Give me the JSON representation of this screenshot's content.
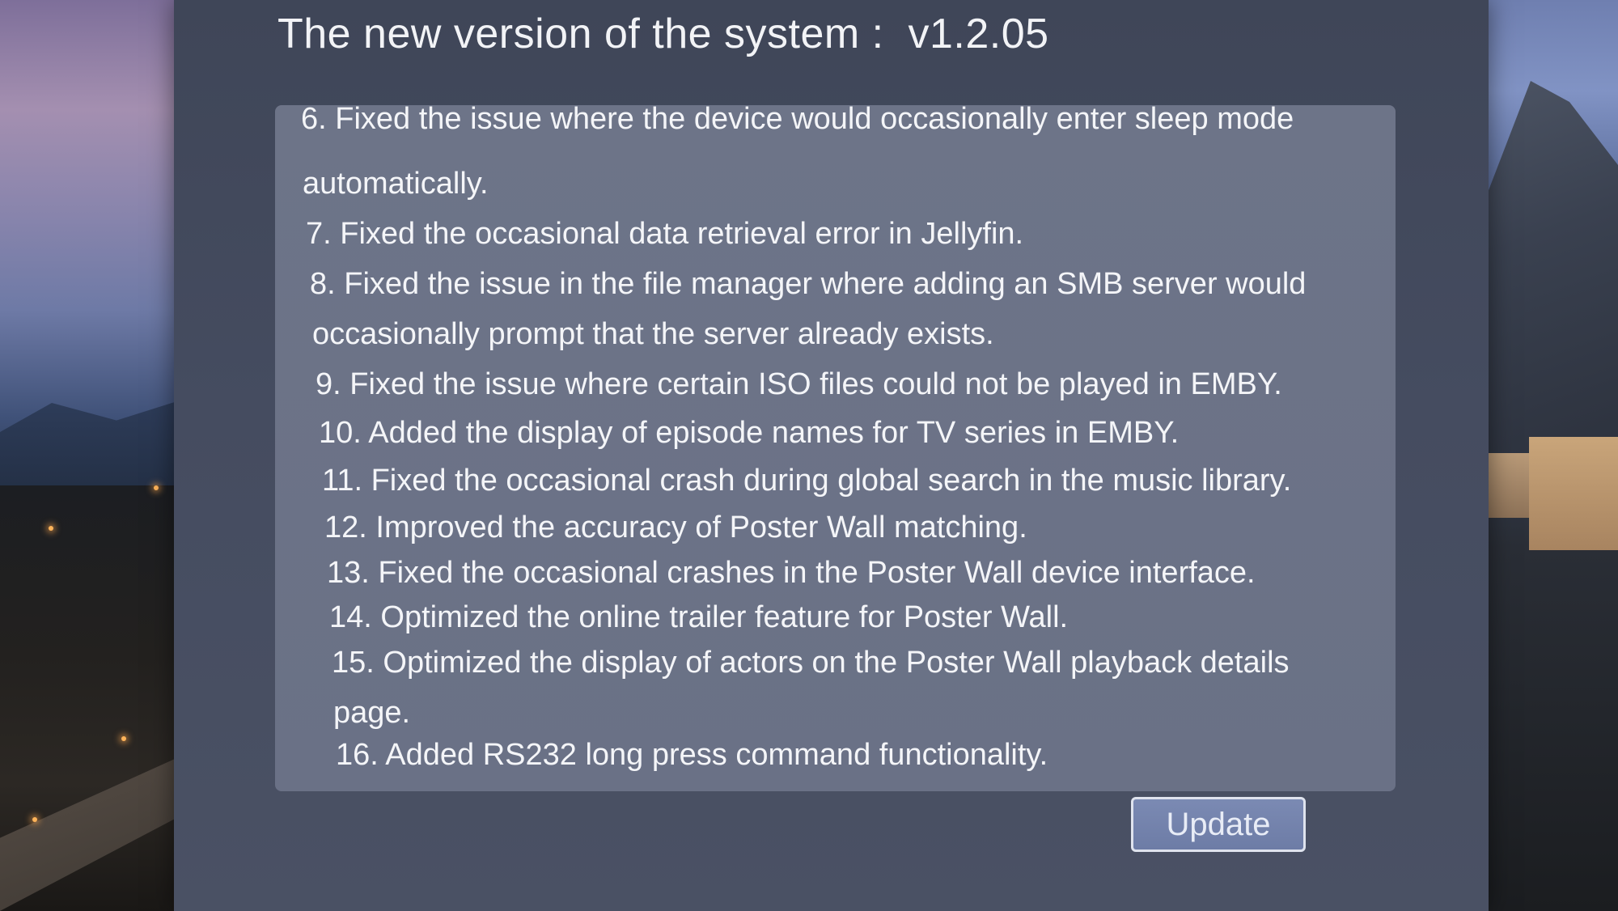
{
  "dialog": {
    "title": "The new version of the system :  v1.2.05",
    "update_button_label": "Update"
  },
  "release_notes": [
    "6. Fixed the issue where the device would occasionally enter sleep mode",
    "automatically.",
    "7. Fixed the occasional data retrieval error in Jellyfin.",
    "8. Fixed the issue in the file manager where adding an SMB server would",
    "occasionally prompt that the server already exists.",
    "9. Fixed the issue where certain ISO files could not be played in EMBY.",
    "10. Added the display of episode names for TV series in EMBY.",
    "11. Fixed the occasional crash during global search in the music library.",
    "12. Improved the accuracy of Poster Wall matching.",
    "13. Fixed the occasional crashes in the Poster Wall device interface.",
    "14. Optimized the online trailer feature for Poster Wall.",
    "15. Optimized the display of actors on the Poster Wall playback details",
    "page.",
    "16. Added RS232 long press command functionality."
  ],
  "colors": {
    "dialog_background": "#454c60",
    "panel_background": "#6d7488",
    "text": "#f4f5f8",
    "button_background": "#7b8ab3",
    "button_border": "#dfe3ee"
  }
}
